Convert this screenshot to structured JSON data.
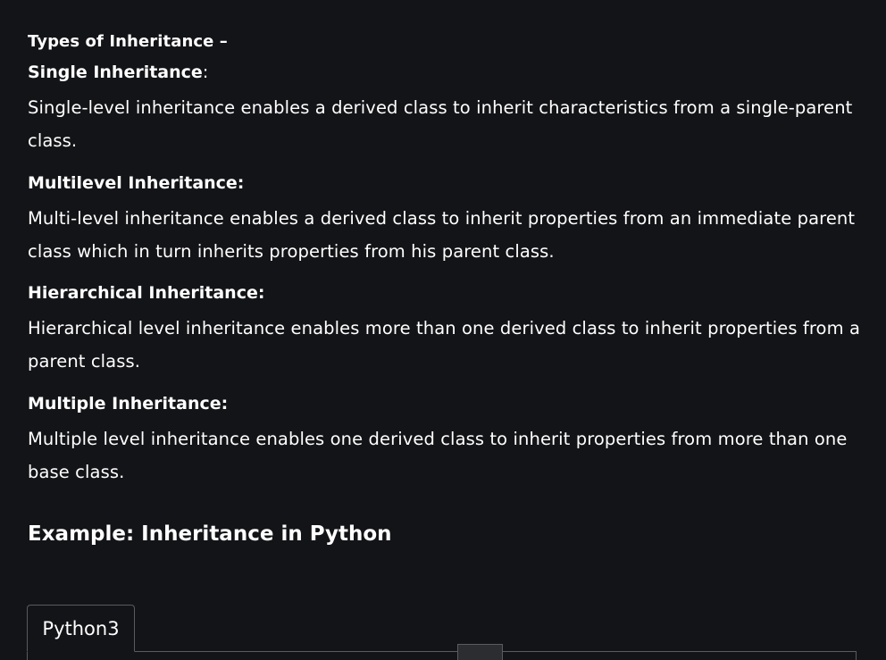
{
  "article": {
    "types_heading": "Types of Inheritance –",
    "sections": [
      {
        "title": "Single Inheritance",
        "colon": ":",
        "body": "Single-level inheritance enables a derived class to inherit characteristics from a single-parent class."
      },
      {
        "title": "Multilevel Inheritance:",
        "colon": "",
        "body": "Multi-level inheritance enables a derived class to inherit properties from an immediate parent class which in turn inherits properties from his parent class."
      },
      {
        "title": "Hierarchical Inheritance:",
        "colon": "",
        "body": "Hierarchical level inheritance enables more than one derived class to inherit properties from a parent class."
      },
      {
        "title": "Multiple Inheritance:",
        "colon": "",
        "body": "Multiple level inheritance enables one derived class to inherit properties from more than one base class."
      }
    ],
    "example_heading": "Example: Inheritance in Python"
  },
  "code_block": {
    "tabs": [
      {
        "label": "Python3",
        "active": true
      }
    ]
  },
  "colors": {
    "background": "#131417",
    "text": "#ffffff",
    "border": "#5a5b5e"
  }
}
